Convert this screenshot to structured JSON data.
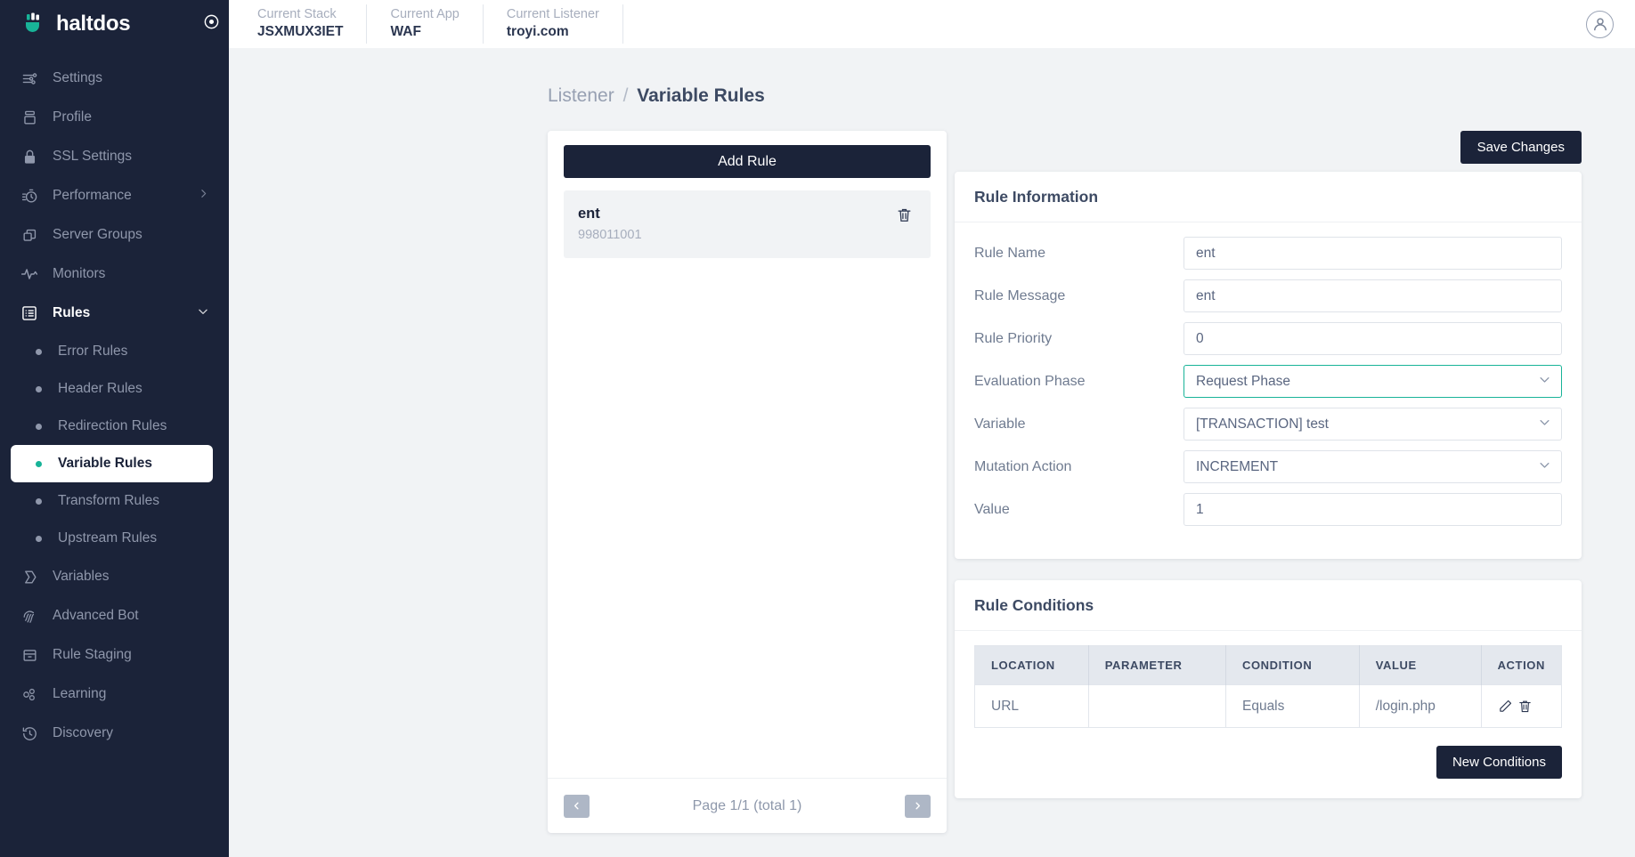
{
  "brand": {
    "name": "haltdos",
    "logo_icon": "haltdos-logo-icon",
    "target_icon": "target-icon"
  },
  "topbar": {
    "contexts": [
      {
        "label": "Current Stack",
        "value": "JSXMUX3IET"
      },
      {
        "label": "Current App",
        "value": "WAF"
      },
      {
        "label": "Current Listener",
        "value": "troyi.com"
      }
    ],
    "avatar_icon": "user-avatar-icon"
  },
  "sidebar": {
    "items": [
      {
        "label": "Settings",
        "icon": "sliders-icon",
        "type": "item"
      },
      {
        "label": "Profile",
        "icon": "profile-box-icon",
        "type": "item"
      },
      {
        "label": "SSL Settings",
        "icon": "lock-icon",
        "type": "item"
      },
      {
        "label": "Performance",
        "icon": "stopwatch-icon",
        "type": "item",
        "chevron": "chevron-right-icon"
      },
      {
        "label": "Server Groups",
        "icon": "servers-icon",
        "type": "item"
      },
      {
        "label": "Monitors",
        "icon": "pulse-icon",
        "type": "item"
      },
      {
        "label": "Rules",
        "icon": "list-box-icon",
        "type": "group",
        "expanded": true,
        "chevron": "chevron-down-icon"
      },
      {
        "label": "Error Rules",
        "type": "sub"
      },
      {
        "label": "Header Rules",
        "type": "sub"
      },
      {
        "label": "Redirection Rules",
        "type": "sub"
      },
      {
        "label": "Variable Rules",
        "type": "sub",
        "active": true
      },
      {
        "label": "Transform Rules",
        "type": "sub"
      },
      {
        "label": "Upstream Rules",
        "type": "sub"
      },
      {
        "label": "Variables",
        "icon": "variable-icon",
        "type": "item"
      },
      {
        "label": "Advanced Bot",
        "icon": "fingerprint-icon",
        "type": "item"
      },
      {
        "label": "Rule Staging",
        "icon": "archive-icon",
        "type": "item"
      },
      {
        "label": "Learning",
        "icon": "nodes-icon",
        "type": "item"
      },
      {
        "label": "Discovery",
        "icon": "history-clock-icon",
        "type": "item"
      }
    ],
    "active_color": "#18b398"
  },
  "breadcrumb": {
    "parent": "Listener",
    "separator": "/",
    "current": "Variable Rules"
  },
  "rules_panel": {
    "add_button": "Add Rule",
    "rules": [
      {
        "name": "ent",
        "id": "998011001",
        "delete_icon": "trash-icon",
        "selected": true
      }
    ],
    "pagination": {
      "prev_icon": "chevron-left-icon",
      "next_icon": "chevron-right-icon",
      "text": "Page 1/1 (total 1)"
    }
  },
  "detail": {
    "save_button": "Save Changes",
    "rule_information": {
      "title": "Rule Information",
      "fields": [
        {
          "label": "Rule Name",
          "value": "ent",
          "control": "input"
        },
        {
          "label": "Rule Message",
          "value": "ent",
          "control": "input"
        },
        {
          "label": "Rule Priority",
          "value": "0",
          "control": "input"
        },
        {
          "label": "Evaluation Phase",
          "value": "Request Phase",
          "control": "select",
          "focused": true,
          "icon": "chevron-down-icon"
        },
        {
          "label": "Variable",
          "value": "[TRANSACTION] test",
          "control": "select",
          "icon": "chevron-down-icon"
        },
        {
          "label": "Mutation Action",
          "value": "INCREMENT",
          "control": "select",
          "icon": "chevron-down-icon"
        },
        {
          "label": "Value",
          "value": "1",
          "control": "input"
        }
      ]
    },
    "rule_conditions": {
      "title": "Rule Conditions",
      "columns": [
        "LOCATION",
        "PARAMETER",
        "CONDITION",
        "VALUE",
        "ACTION"
      ],
      "rows": [
        {
          "location": "URL",
          "parameter": "",
          "condition": "Equals",
          "value": "/login.php",
          "edit_icon": "pencil-icon",
          "delete_icon": "trash-icon"
        }
      ],
      "new_button": "New Conditions"
    }
  }
}
